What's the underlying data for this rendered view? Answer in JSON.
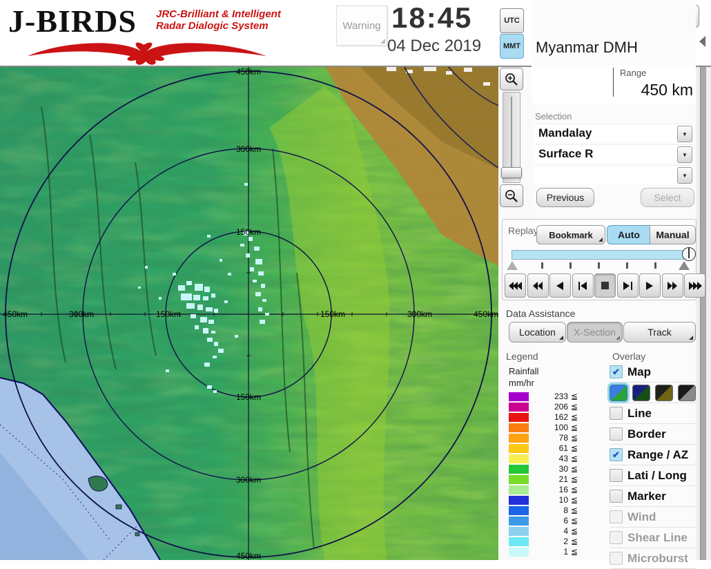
{
  "header": {
    "logo": {
      "title": "J-BIRDS",
      "subtitle_line1": "JRC-Brilliant & Intelligent",
      "subtitle_line2": "Radar  Dialogic  System"
    },
    "warning_label": "Warning",
    "clock": {
      "time": "18:45",
      "date": "04 Dec 2019"
    },
    "timezone": {
      "utc_label": "UTC",
      "mmt_label": "MMT",
      "selected": "MMT"
    },
    "toolbar_icons": [
      "save-icon",
      "print-icon",
      "open-folder-icon",
      "add-image-icon",
      "help-icon"
    ],
    "toolbar_selected": "save-icon"
  },
  "station": {
    "title": "Myanmar DMH",
    "range_label": "Range",
    "range_value": "450 km"
  },
  "selection": {
    "label": "Selection",
    "dropdown1": "Mandalay",
    "dropdown2": "Surface R",
    "dropdown3": "",
    "previous_label": "Previous",
    "select_label": "Select"
  },
  "replay": {
    "label": "Replay",
    "bookmark_label": "Bookmark",
    "auto_label": "Auto",
    "manual_label": "Manual",
    "mode_selected": "Auto",
    "slider_position_pct": 100,
    "playback_icons": [
      "fast-rewind-triple-icon",
      "rewind-double-icon",
      "play-reverse-icon",
      "step-back-icon",
      "stop-icon",
      "step-forward-icon",
      "play-icon",
      "forward-double-icon",
      "fast-forward-triple-icon"
    ],
    "pressed_button": "stop"
  },
  "data_assistance": {
    "label": "Data Assistance",
    "buttons": [
      {
        "label": "Location",
        "enabled": true
      },
      {
        "label": "X-Section",
        "enabled": false
      },
      {
        "label": "Track",
        "enabled": true
      }
    ]
  },
  "legend": {
    "label": "Legend",
    "title_line1": "Rainfall",
    "title_line2": "mm/hr",
    "operator": "≦",
    "items": [
      {
        "value": "233",
        "color": "#a400cc"
      },
      {
        "value": "206",
        "color": "#cc0090"
      },
      {
        "value": "162",
        "color": "#e81414"
      },
      {
        "value": "100",
        "color": "#fb7d12"
      },
      {
        "value": "78",
        "color": "#ffa312"
      },
      {
        "value": "61",
        "color": "#ffc812"
      },
      {
        "value": "43",
        "color": "#f7ef52"
      },
      {
        "value": "30",
        "color": "#23c836"
      },
      {
        "value": "21",
        "color": "#77dc28"
      },
      {
        "value": "16",
        "color": "#a9ec92"
      },
      {
        "value": "10",
        "color": "#2330d8"
      },
      {
        "value": "8",
        "color": "#1a64e8"
      },
      {
        "value": "6",
        "color": "#3a9ae8"
      },
      {
        "value": "4",
        "color": "#8cd0f0"
      },
      {
        "value": "2",
        "color": "#6ceaf2"
      },
      {
        "value": "1",
        "color": "#c9f9f9"
      }
    ]
  },
  "overlay": {
    "label": "Overlay",
    "items": [
      {
        "label": "Map",
        "checked": true,
        "enabled": true
      },
      {
        "label": "Line",
        "checked": false,
        "enabled": true
      },
      {
        "label": "Border",
        "checked": false,
        "enabled": true
      },
      {
        "label": "Range / AZ",
        "checked": true,
        "enabled": true
      },
      {
        "label": "Lati / Long",
        "checked": false,
        "enabled": true
      },
      {
        "label": "Marker",
        "checked": false,
        "enabled": true
      },
      {
        "label": "Wind",
        "checked": false,
        "enabled": false
      },
      {
        "label": "Shear Line",
        "checked": false,
        "enabled": false
      },
      {
        "label": "Microburst",
        "checked": false,
        "enabled": false
      }
    ],
    "check_glyph": "✔",
    "map_style_selected": 0
  },
  "map": {
    "axis_labels": {
      "top": [
        "450km",
        "300km",
        "150km"
      ],
      "bottom": [
        "150km",
        "300km",
        "450km"
      ],
      "left": [
        "450km",
        "300km",
        "150km"
      ],
      "right": [
        "150km",
        "300km",
        "450km"
      ]
    },
    "ring_radii_km": [
      150,
      300,
      450
    ]
  },
  "colors": {
    "accent_blue": "#a9dcf2",
    "selected_tool": "#84cdea",
    "logo_red": "#cc1313",
    "ring_line": "#10104a",
    "sea": "#a6c2e6",
    "echo": "#c8f6f6"
  }
}
